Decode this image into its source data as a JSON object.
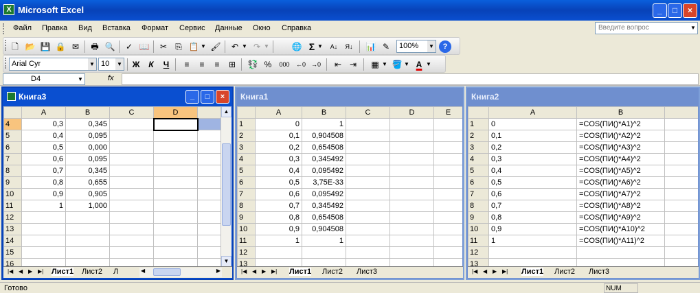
{
  "app": {
    "title": "Microsoft Excel",
    "icon": "excel-icon"
  },
  "menu": [
    "Файл",
    "Правка",
    "Вид",
    "Вставка",
    "Формат",
    "Сервис",
    "Данные",
    "Окно",
    "Справка"
  ],
  "help_search": {
    "placeholder": "Введите вопрос"
  },
  "toolbar": {
    "zoom": "100%",
    "font": "Arial Cyr",
    "size": "10",
    "bold": "Ж",
    "italic": "К",
    "underline": "Ч",
    "percent": "%",
    "thousands": "000"
  },
  "formula_bar": {
    "cell_ref": "D4",
    "fx_label": "fx",
    "value": ""
  },
  "status": {
    "ready": "Готово",
    "num": "NUM"
  },
  "workbooks": [
    {
      "title": "Книга3",
      "columns": [
        "A",
        "B",
        "C",
        "D",
        ""
      ],
      "rows": [
        {
          "n": "4",
          "a": "0,3",
          "b": "0,345"
        },
        {
          "n": "5",
          "a": "0,4",
          "b": "0,095"
        },
        {
          "n": "6",
          "a": "0,5",
          "b": "0,000"
        },
        {
          "n": "7",
          "a": "0,6",
          "b": "0,095"
        },
        {
          "n": "8",
          "a": "0,7",
          "b": "0,345"
        },
        {
          "n": "9",
          "a": "0,8",
          "b": "0,655"
        },
        {
          "n": "10",
          "a": "0,9",
          "b": "0,905"
        },
        {
          "n": "11",
          "a": "1",
          "b": "1,000"
        },
        {
          "n": "12",
          "a": "",
          "b": ""
        },
        {
          "n": "13",
          "a": "",
          "b": ""
        },
        {
          "n": "14",
          "a": "",
          "b": ""
        },
        {
          "n": "15",
          "a": "",
          "b": ""
        },
        {
          "n": "16",
          "a": "",
          "b": ""
        }
      ],
      "tabs": [
        "Лист1",
        "Лист2",
        "Л"
      ]
    },
    {
      "title": "Книга1",
      "columns": [
        "A",
        "B",
        "C",
        "D",
        "E"
      ],
      "rows": [
        {
          "n": "1",
          "a": "0",
          "b": "1"
        },
        {
          "n": "2",
          "a": "0,1",
          "b": "0,904508"
        },
        {
          "n": "3",
          "a": "0,2",
          "b": "0,654508"
        },
        {
          "n": "4",
          "a": "0,3",
          "b": "0,345492"
        },
        {
          "n": "5",
          "a": "0,4",
          "b": "0,095492"
        },
        {
          "n": "6",
          "a": "0,5",
          "b": "3,75E-33"
        },
        {
          "n": "7",
          "a": "0,6",
          "b": "0,095492"
        },
        {
          "n": "8",
          "a": "0,7",
          "b": "0,345492"
        },
        {
          "n": "9",
          "a": "0,8",
          "b": "0,654508"
        },
        {
          "n": "10",
          "a": "0,9",
          "b": "0,904508"
        },
        {
          "n": "11",
          "a": "1",
          "b": "1"
        },
        {
          "n": "12",
          "a": "",
          "b": ""
        },
        {
          "n": "13",
          "a": "",
          "b": ""
        }
      ],
      "tabs": [
        "Лист1",
        "Лист2",
        "Лист3"
      ]
    },
    {
      "title": "Книга2",
      "columns": [
        "A",
        "B"
      ],
      "rows": [
        {
          "n": "1",
          "a": "0",
          "b": "=COS(ПИ()*A1)^2"
        },
        {
          "n": "2",
          "a": "0,1",
          "b": "=COS(ПИ()*A2)^2"
        },
        {
          "n": "3",
          "a": "0,2",
          "b": "=COS(ПИ()*A3)^2"
        },
        {
          "n": "4",
          "a": "0,3",
          "b": "=COS(ПИ()*A4)^2"
        },
        {
          "n": "5",
          "a": "0,4",
          "b": "=COS(ПИ()*A5)^2"
        },
        {
          "n": "6",
          "a": "0,5",
          "b": "=COS(ПИ()*A6)^2"
        },
        {
          "n": "7",
          "a": "0,6",
          "b": "=COS(ПИ()*A7)^2"
        },
        {
          "n": "8",
          "a": "0,7",
          "b": "=COS(ПИ()*A8)^2"
        },
        {
          "n": "9",
          "a": "0,8",
          "b": "=COS(ПИ()*A9)^2"
        },
        {
          "n": "10",
          "a": "0,9",
          "b": "=COS(ПИ()*A10)^2"
        },
        {
          "n": "11",
          "a": "1",
          "b": "=COS(ПИ()*A11)^2"
        },
        {
          "n": "12",
          "a": "",
          "b": ""
        },
        {
          "n": "13",
          "a": "",
          "b": ""
        }
      ],
      "tabs": [
        "Лист1",
        "Лист2",
        "Лист3"
      ]
    }
  ]
}
